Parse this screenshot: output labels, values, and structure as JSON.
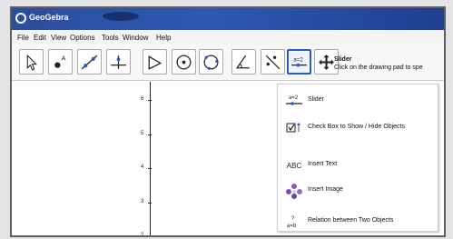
{
  "app": {
    "title": "GeoGebra"
  },
  "menu": [
    "File",
    "Edit",
    "View",
    "Options",
    "Tools",
    "Window",
    "Help"
  ],
  "toolbar": {
    "tools": [
      {
        "name": "move-tool",
        "icon": "arrow-pointer-icon"
      },
      {
        "name": "point-tool",
        "icon": "point-icon"
      },
      {
        "name": "line-tool",
        "icon": "line-through-points-icon"
      },
      {
        "name": "perpendicular-tool",
        "icon": "perpendicular-line-icon"
      },
      {
        "name": "polygon-tool",
        "icon": "polygon-icon"
      },
      {
        "name": "circle-tool",
        "icon": "circle-center-point-icon"
      },
      {
        "name": "circle-three-points-tool",
        "icon": "circle-three-points-icon"
      },
      {
        "name": "angle-tool",
        "icon": "angle-icon"
      },
      {
        "name": "reflect-tool",
        "icon": "reflect-about-line-icon"
      },
      {
        "name": "slider-tool",
        "icon": "slider-icon",
        "label": "a=2",
        "selected": true
      },
      {
        "name": "move-graphics-tool",
        "icon": "move-graphics-view-icon"
      }
    ],
    "info_title": "Slider",
    "info_text": "Click on the drawing pad to spe"
  },
  "graphics": {
    "y_ticks": [
      "6",
      "5",
      "4",
      "3",
      "2"
    ]
  },
  "dropdown": {
    "items": [
      {
        "label": "Slider",
        "icon": "slider-icon",
        "icon_text": "a=2"
      },
      {
        "label": "Check Box to Show / Hide Objects",
        "icon": "checkbox-icon"
      },
      {
        "label": "Insert Text",
        "icon": "text-abc-icon",
        "icon_text": "ABC"
      },
      {
        "label": "Insert Image",
        "icon": "image-icon"
      },
      {
        "label": "Relation between Two Objects",
        "icon": "relation-icon",
        "icon_text": "a=b"
      }
    ]
  },
  "colors": {
    "title_bar": "#2e58b4",
    "accent": "#2a5fb8"
  }
}
